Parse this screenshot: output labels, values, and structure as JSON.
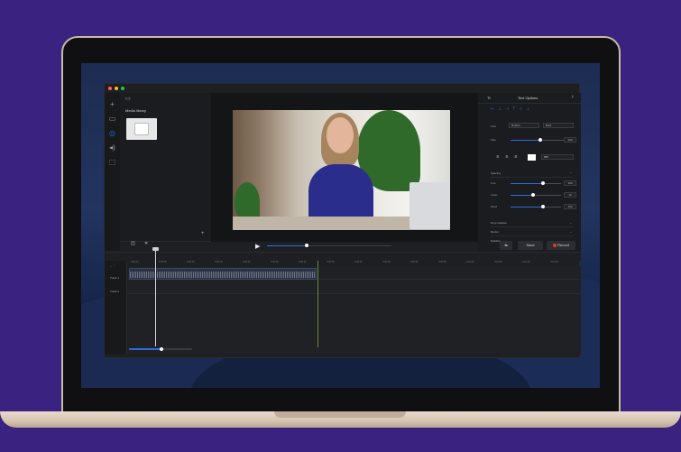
{
  "colors": {
    "background": "#3a2380",
    "accent": "#2d6cdf",
    "record": "#d93a3a"
  },
  "icons": [
    "plus-icon",
    "folder-icon",
    "media-icon",
    "audio-icon",
    "export-icon",
    "play-icon",
    "split-icon",
    "delete-icon",
    "chevron-right-icon",
    "record-icon"
  ],
  "media_library": {
    "title": "Media library"
  },
  "text_options": {
    "tab_label": "Tt",
    "title": "Text Options",
    "font_label": "Font",
    "font_value": "Roboto",
    "weight_value": "Bold",
    "size_label": "Size",
    "size_value": "100",
    "size_level": 0.55,
    "color_value": "ffffff",
    "spacing": {
      "title": "Spacing",
      "rows": [
        {
          "label": "Line",
          "value": "100",
          "level": 0.65
        },
        {
          "label": "Letter",
          "value": "10",
          "level": 0.45
        },
        {
          "label": "Word",
          "value": "100",
          "level": 0.65
        }
      ]
    },
    "drop_shadow": "Drop shadow",
    "border": "Border",
    "padding": "Padding"
  },
  "player": {
    "progress": 0.32
  },
  "buttons": {
    "save": "Save",
    "record": "Record"
  },
  "timeline": {
    "tracks": [
      "Track 1",
      "Track 2"
    ],
    "ruler_ticks": [
      "0:00:00",
      "0:00:05",
      "0:00:10",
      "0:00:15",
      "0:00:20",
      "0:00:25",
      "0:00:30",
      "0:00:35",
      "0:00:40",
      "0:00:45",
      "0:00:50",
      "0:00:55",
      "0:01:00",
      "0:01:05",
      "0:01:10",
      "0:01:15"
    ],
    "zoom_level": 0.52
  }
}
